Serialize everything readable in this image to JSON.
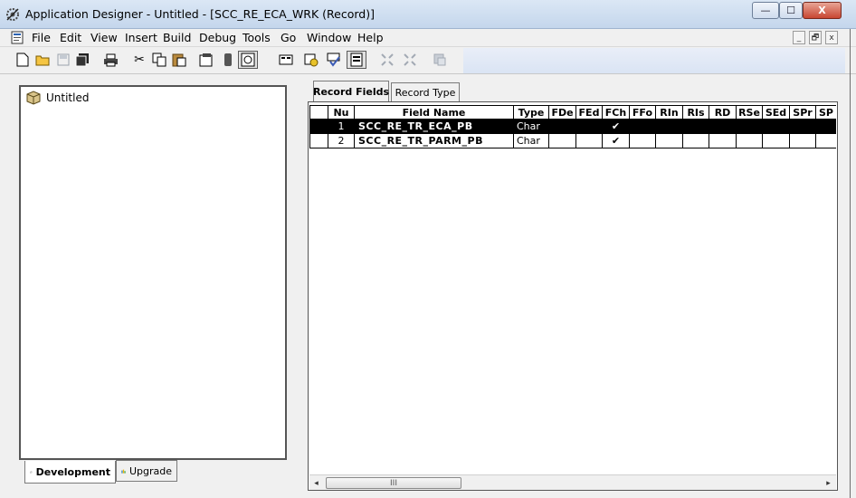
{
  "window": {
    "title": "Application Designer - Untitled - [SCC_RE_ECA_WRK (Record)]",
    "controls": {
      "minimize": "—",
      "maximize": "☐",
      "close": "X"
    }
  },
  "menu": {
    "items": [
      "File",
      "Edit",
      "View",
      "Insert",
      "Build",
      "Debug",
      "Tools",
      "Go",
      "Window",
      "Help"
    ],
    "mdi_controls": [
      "_",
      "🗗",
      "x"
    ]
  },
  "toolbar": {
    "icons": [
      "new-document-icon",
      "open-folder-icon",
      "save-icon",
      "save-all-icon",
      "print-icon",
      "cut-icon",
      "copy-icon",
      "paste-icon",
      "properties-icon",
      "project-icon",
      "view-definition-icon",
      "view-peoplecode-icon",
      "validate-icon",
      "view-field-icon",
      "expand-icon",
      "collapse-icon",
      "find-definition-icon"
    ]
  },
  "project_tree": {
    "root_label": "Untitled"
  },
  "left_tabs": {
    "development": "Development",
    "upgrade": "Upgrade"
  },
  "record_tabs": {
    "fields": "Record Fields",
    "type": "Record Type"
  },
  "field_grid": {
    "columns": [
      "Nu",
      "Field Name",
      "Type",
      "FDe",
      "FEd",
      "FCh",
      "FFo",
      "RIn",
      "RIs",
      "RD",
      "RSe",
      "SEd",
      "SPr",
      "SP"
    ],
    "rows": [
      {
        "num": "1",
        "field_name": "SCC_RE_TR_ECA_PB",
        "type": "Char",
        "fch_check": "✔",
        "selected": true
      },
      {
        "num": "2",
        "field_name": "SCC_RE_TR_PARM_PB",
        "type": "Char",
        "fch_check": "✔",
        "selected": false
      }
    ]
  },
  "scrollbar": {
    "left_arrow": "◂",
    "right_arrow": "▸",
    "thumb_grip": "III"
  }
}
